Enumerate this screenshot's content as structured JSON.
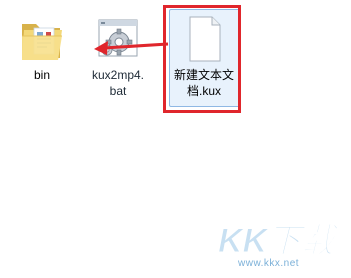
{
  "files": [
    {
      "name": "bin",
      "icon": "folder-icon"
    },
    {
      "name_line1": "kux2mp4.",
      "name_line2": "bat",
      "icon": "batch-file-icon"
    },
    {
      "name_line1": "新建文本文",
      "name_line2": "档.kux",
      "icon": "blank-document-icon"
    }
  ],
  "annotation": {
    "arrow_color": "#e0262c",
    "box_color": "#e0262c"
  },
  "watermark": {
    "brand": "KK下载",
    "url": "www.kkx.net"
  },
  "colors": {
    "selection_fill": "#e8f2fc",
    "selection_border": "#8fb8e4"
  }
}
